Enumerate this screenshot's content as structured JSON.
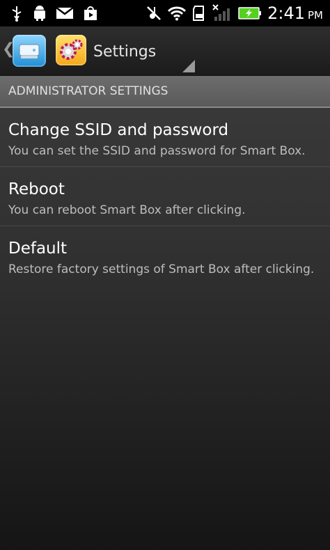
{
  "status_bar": {
    "time": "2:41",
    "ampm": "PM",
    "icons": [
      "usb-icon",
      "android-debug-icon",
      "gmail-icon",
      "play-store-icon",
      "no-sound-icon",
      "wifi-icon",
      "sd-card-icon",
      "signal-icon",
      "battery-icon"
    ]
  },
  "action_bar": {
    "title": "Settings",
    "app_icon": "smart-box-app-icon",
    "settings_icon": "settings-gears-icon"
  },
  "section": {
    "header": "ADMINISTRATOR SETTINGS",
    "items": [
      {
        "title": "Change SSID and password",
        "description": "You can set the SSID and password for Smart Box."
      },
      {
        "title": "Reboot",
        "description": "You can reboot Smart Box after clicking."
      },
      {
        "title": "Default",
        "description": "Restore factory settings of Smart Box after clicking."
      }
    ]
  },
  "colors": {
    "section_header_bg": "#626262",
    "battery_green": "#54d11f"
  }
}
